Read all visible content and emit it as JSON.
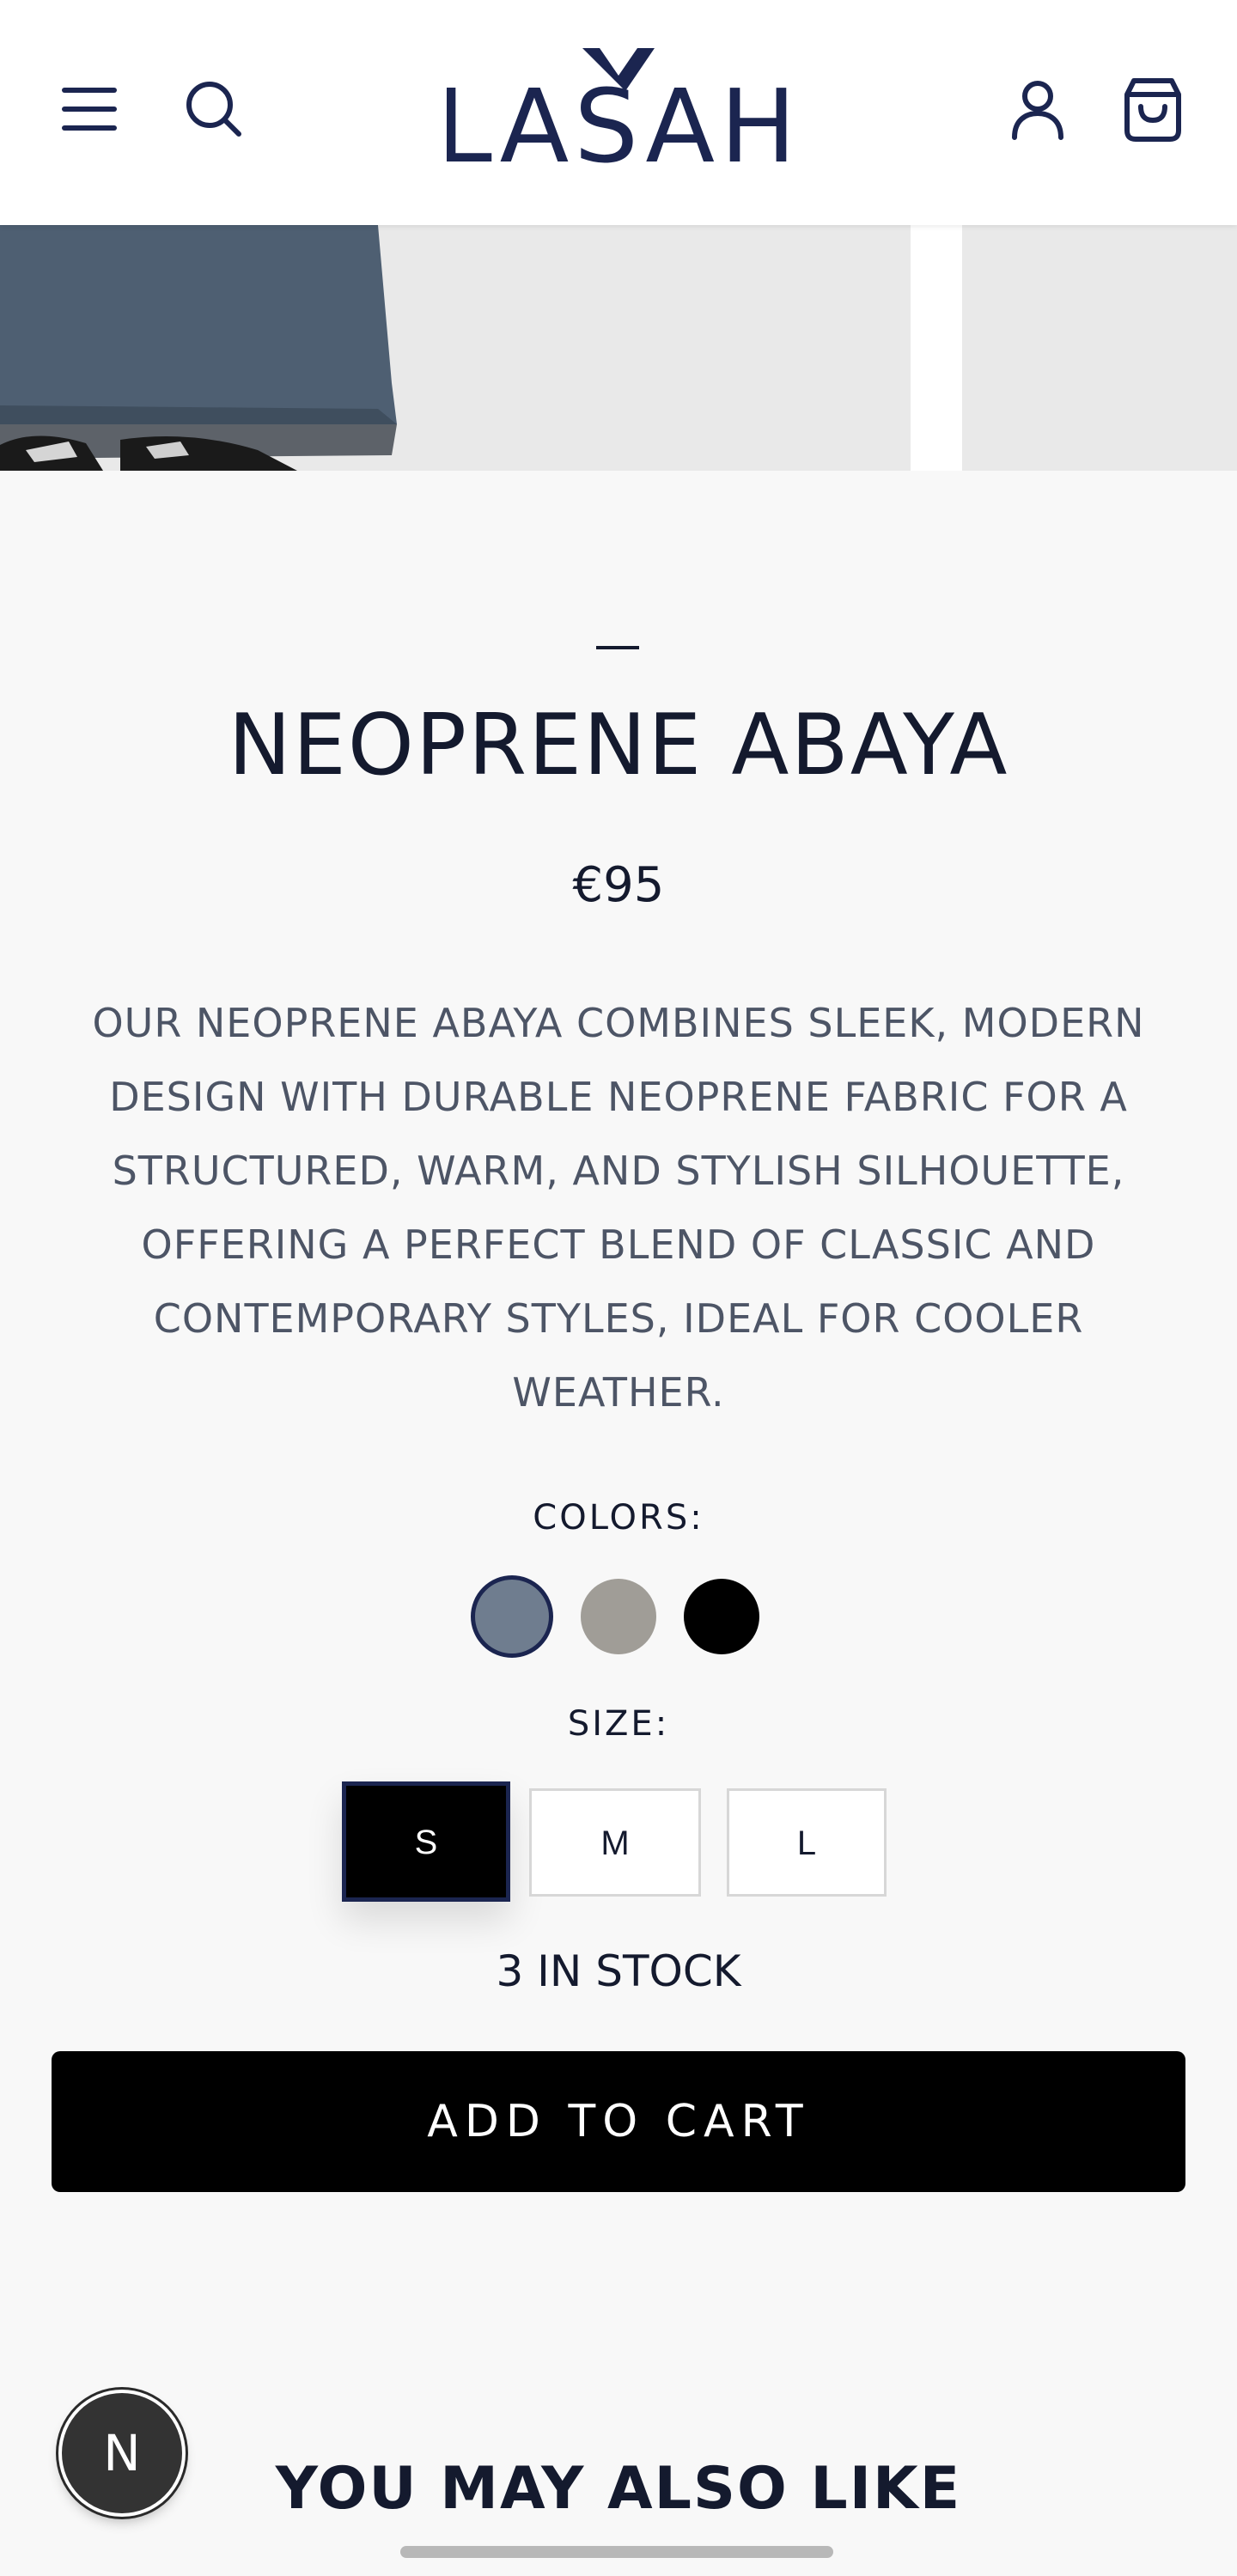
{
  "header": {
    "menu_icon": "hamburger-menu-icon",
    "search_icon": "search-icon",
    "account_icon": "user-icon",
    "cart_icon": "shopping-bag-icon",
    "logo_text": "LASAH"
  },
  "gallery": {
    "image_alt_main": "product-photo",
    "image_alt_next": "product-photo"
  },
  "product": {
    "dash": "—",
    "title": "NEOPRENE ABAYA",
    "price": "€95",
    "description": "OUR NEOPRENE ABAYA COMBINES SLEEK, MODERN DESIGN WITH DURABLE NEOPRENE FABRIC FOR A STRUCTURED, WARM, AND STYLISH SILHOUETTE, OFFERING A PERFECT BLEND OF CLASSIC AND CONTEMPORARY STYLES, IDEAL FOR COOLER WEATHER.",
    "colors_label": "COLORS:",
    "colors": [
      {
        "hex": "#6f7d8f",
        "selected": true
      },
      {
        "hex": "#a09d97",
        "selected": false
      },
      {
        "hex": "#000000",
        "selected": false
      }
    ],
    "size_label": "SIZE:",
    "sizes": [
      {
        "label": "S",
        "selected": true
      },
      {
        "label": "M",
        "selected": false
      },
      {
        "label": "L",
        "selected": false
      }
    ],
    "stock": "3 IN STOCK",
    "add_to_cart": "ADD TO CART"
  },
  "related": {
    "title": "YOU MAY ALSO LIKE"
  },
  "fab": {
    "label": "N"
  },
  "colors": {
    "brand_navy": "#1b2550",
    "text_dark": "#141a2e",
    "text_muted": "#4d5566",
    "button_black": "#000000"
  }
}
